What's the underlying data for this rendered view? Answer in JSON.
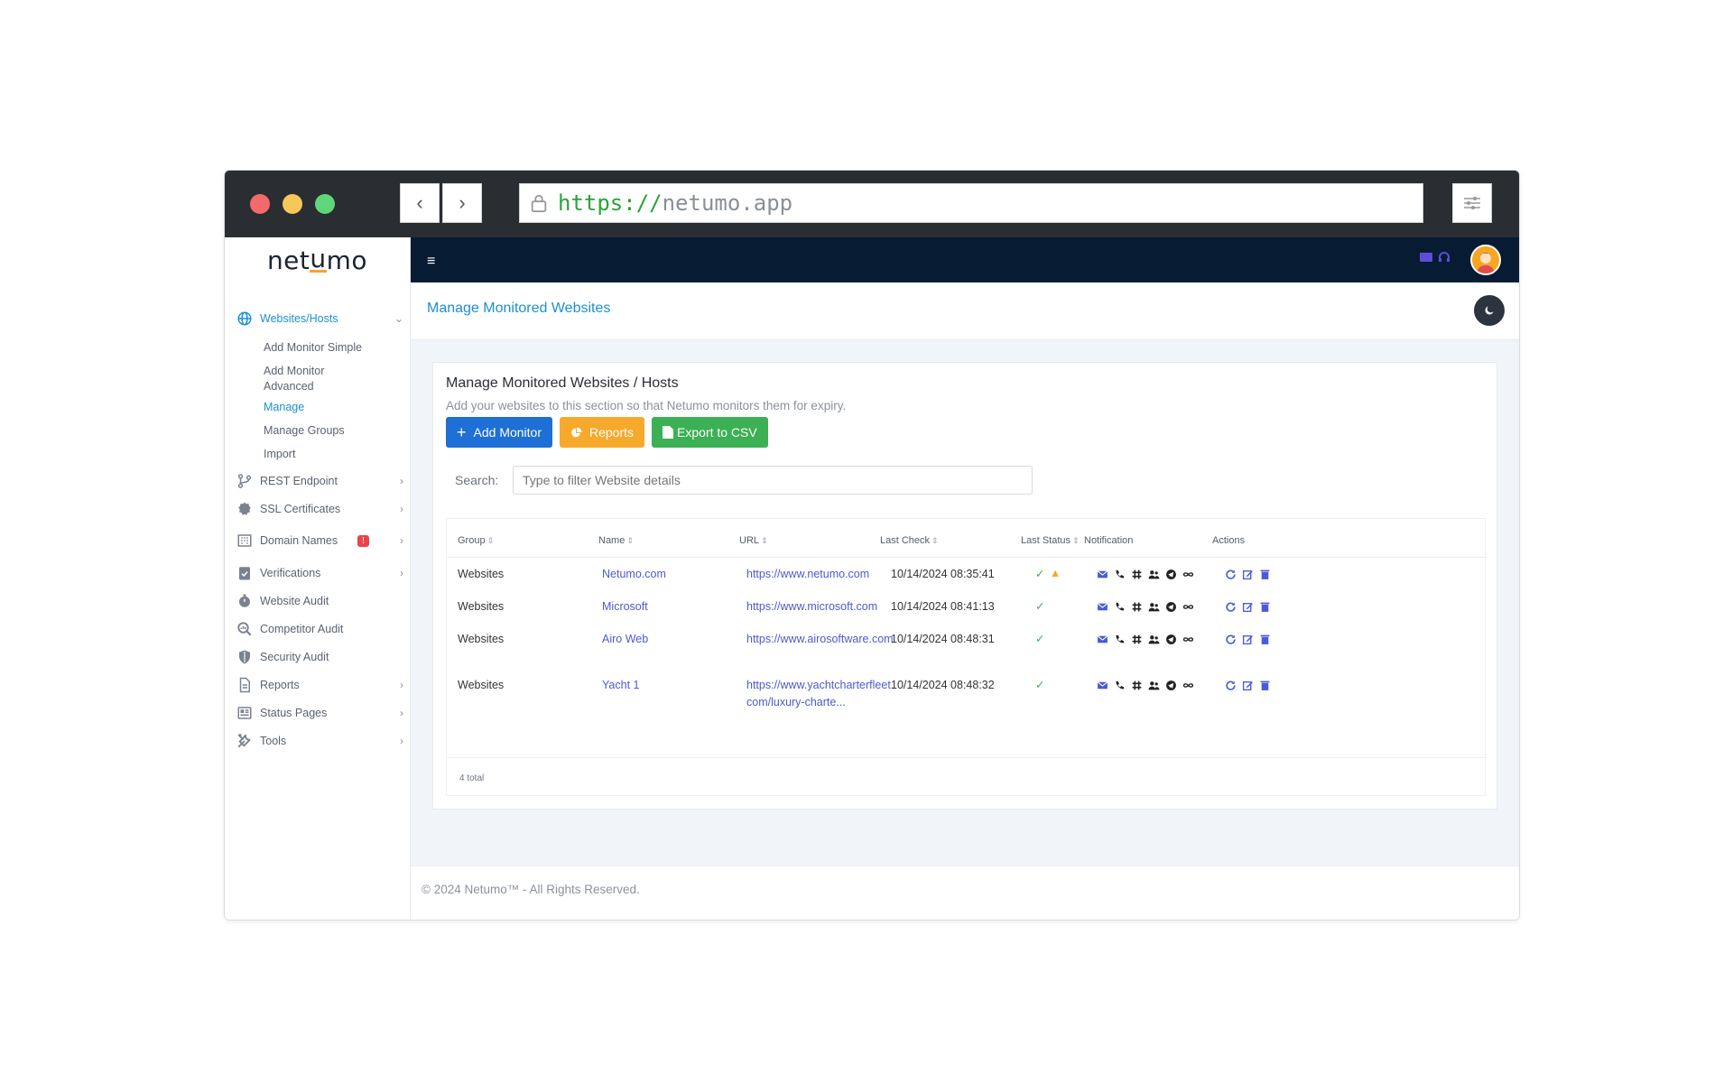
{
  "browser": {
    "url_scheme": "https://",
    "url_host": "netumo.app"
  },
  "brand": {
    "logo_pre": "net",
    "logo_u": "u",
    "logo_post": "mo"
  },
  "sidebar": {
    "section": "Websites/Hosts",
    "sub_items": [
      "Add Monitor Simple",
      "Add Monitor Advanced",
      "Manage",
      "Manage Groups",
      "Import"
    ],
    "items": [
      {
        "label": "REST Endpoint"
      },
      {
        "label": "SSL Certificates"
      },
      {
        "label": "Domain Names",
        "badge": "!"
      },
      {
        "label": "Verifications"
      },
      {
        "label": "Website Audit"
      },
      {
        "label": "Competitor Audit"
      },
      {
        "label": "Security Audit"
      },
      {
        "label": "Reports"
      },
      {
        "label": "Status Pages"
      },
      {
        "label": "Tools"
      }
    ]
  },
  "page": {
    "title": "Manage Monitored Websites"
  },
  "card": {
    "title": "Manage Monitored Websites / Hosts",
    "subtitle": "Add your websites to this section so that Netumo monitors them for expiry.",
    "add_label": "Add Monitor",
    "reports_label": "Reports",
    "export_label": "Export to CSV",
    "search_label": "Search:",
    "search_placeholder": "Type to filter Website details"
  },
  "table": {
    "headers": [
      "Group",
      "Name",
      "URL",
      "Last Check",
      "Last Status",
      "Notification",
      "Actions"
    ],
    "rows": [
      {
        "group": "Websites",
        "name": "Netumo.com",
        "url": "https://www.netumo.com",
        "last_check": "10/14/2024 08:35:41",
        "warn": true
      },
      {
        "group": "Websites",
        "name": "Microsoft",
        "url": "https://www.microsoft.com",
        "last_check": "10/14/2024 08:41:13",
        "warn": false
      },
      {
        "group": "Websites",
        "name": "Airo Web",
        "url": "https://www.airosoftware.com",
        "last_check": "10/14/2024 08:48:31",
        "warn": false
      },
      {
        "group": "Websites",
        "name": "Yacht 1",
        "url": "https://www.yachtcharterfleet.com/luxury-charte...",
        "last_check": "10/14/2024 08:48:32",
        "warn": false
      }
    ],
    "total": "4 total"
  },
  "footer": {
    "text": "© 2024 Netumo™ - All Rights Reserved."
  },
  "colors": {
    "accent": "#1b8fd6",
    "topbar": "#071c33",
    "link": "#4b5ad6",
    "success": "#3cb054",
    "warning": "#f7a92b"
  }
}
